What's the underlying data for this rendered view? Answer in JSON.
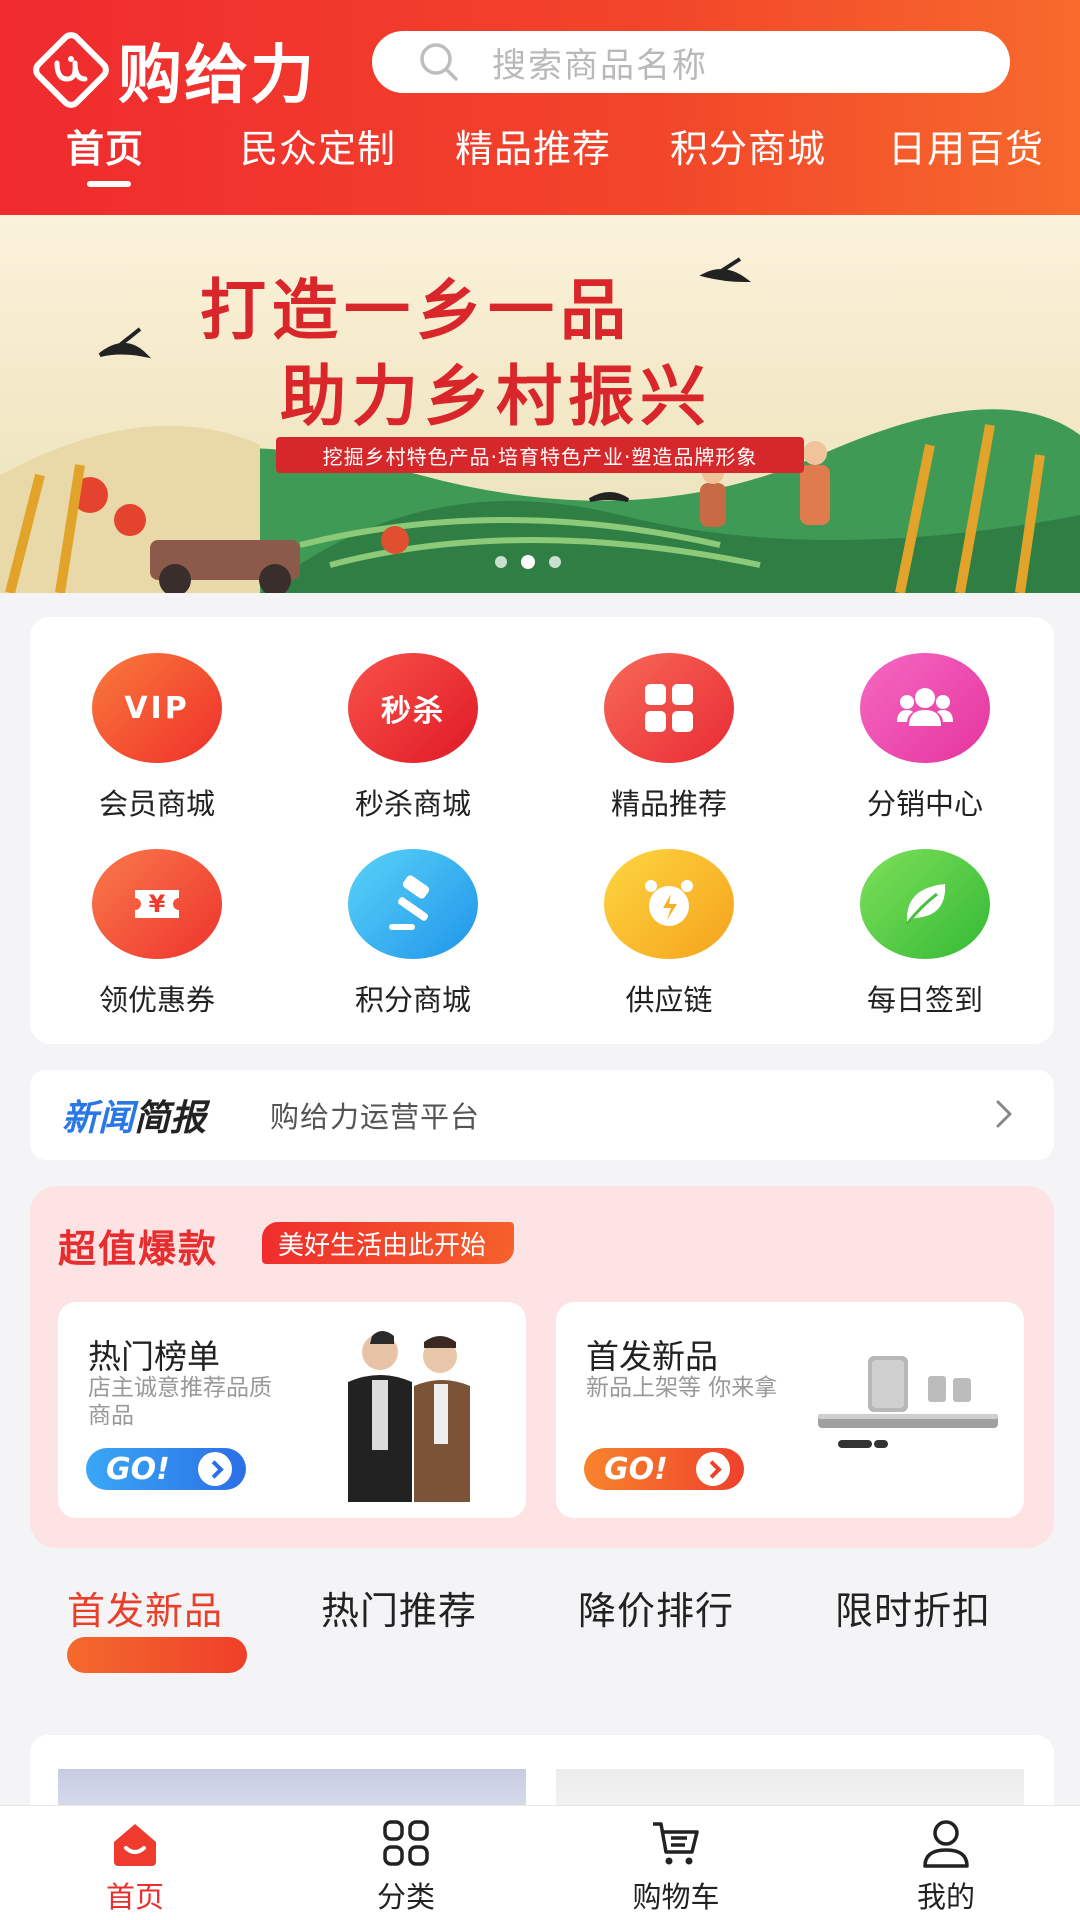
{
  "app": {
    "name": "购给力"
  },
  "search": {
    "placeholder": "搜索商品名称"
  },
  "top_tabs": [
    "首页",
    "民众定制",
    "精品推荐",
    "积分商城",
    "日用百货"
  ],
  "banner": {
    "title_line1": "打造一乡一品",
    "title_line2": "助力乡村振兴",
    "subtitle": "挖掘乡村特色产品·培育特色产业·塑造品牌形象",
    "slide_count": 3,
    "active_slide": 2
  },
  "quick_menu": [
    {
      "label": "会员商城",
      "icon": "vip-icon",
      "badge": "VIP",
      "color": "#f4482a"
    },
    {
      "label": "秒杀商城",
      "icon": "flash-sale-icon",
      "badge": "秒杀",
      "color": "#ef2730"
    },
    {
      "label": "精品推荐",
      "icon": "grid-icon",
      "badge": "",
      "color": "#f03a3e"
    },
    {
      "label": "分销中心",
      "icon": "users-icon",
      "badge": "",
      "color": "#ee3fa6"
    },
    {
      "label": "领优惠券",
      "icon": "coupon-icon",
      "badge": "¥",
      "color": "#f2462e"
    },
    {
      "label": "积分商城",
      "icon": "gavel-icon",
      "badge": "",
      "color": "#2ba8f0"
    },
    {
      "label": "供应链",
      "icon": "alarm-clock-icon",
      "badge": "",
      "color": "#f9b525"
    },
    {
      "label": "每日签到",
      "icon": "leaf-icon",
      "badge": "",
      "color": "#4ccb3c"
    }
  ],
  "news": {
    "tag_part1": "新闻",
    "tag_part2": "简报",
    "text": "购给力运营平台"
  },
  "deals": {
    "title": "超值爆款",
    "tag": "美好生活由此开始",
    "cards": [
      {
        "title": "热门榜单",
        "desc": "店主诚意推荐品质商品",
        "button": "GO!"
      },
      {
        "title": "首发新品",
        "desc": "新品上架等 你来拿",
        "button": "GO!"
      }
    ]
  },
  "product_tabs": [
    "首发新品",
    "热门推荐",
    "降价排行",
    "限时折扣"
  ],
  "bottom_nav": [
    {
      "label": "首页",
      "icon": "home-icon"
    },
    {
      "label": "分类",
      "icon": "category-icon"
    },
    {
      "label": "购物车",
      "icon": "cart-icon"
    },
    {
      "label": "我的",
      "icon": "user-icon"
    }
  ],
  "colors": {
    "brand": "#f02a2f",
    "accent": "#e9402c",
    "news_blue": "#2a78e6"
  }
}
